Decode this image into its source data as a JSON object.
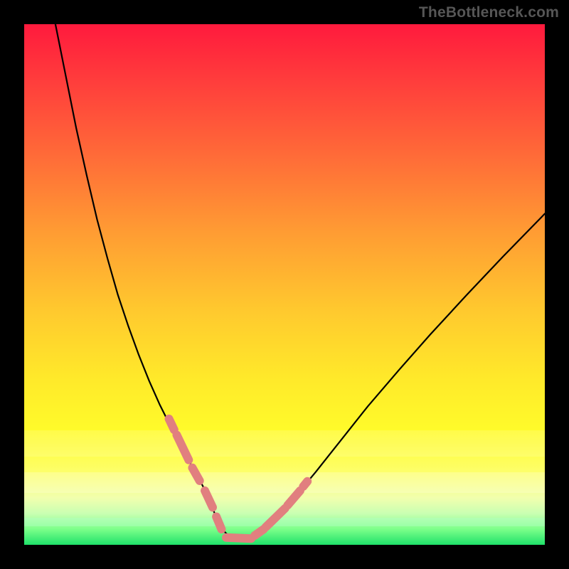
{
  "attribution": "TheBottleneck.com",
  "chart_data": {
    "type": "line",
    "title": "",
    "xlabel": "",
    "ylabel": "",
    "xlim": [
      0,
      100
    ],
    "ylim": [
      0,
      100
    ],
    "grid": false,
    "legend": false,
    "series": [
      {
        "name": "curve",
        "stroke": "#000000",
        "stroke_width": 2.2,
        "x": [
          6,
          8,
          10,
          12,
          14,
          16,
          18,
          20,
          22,
          24,
          26,
          28,
          30,
          32,
          33.5,
          35,
          36,
          37,
          38,
          39.5,
          41,
          42.5,
          44,
          47,
          51,
          56,
          61,
          66,
          72,
          78,
          85,
          92,
          100
        ],
        "y": [
          100,
          90,
          80,
          71,
          62.5,
          55,
          48,
          42,
          36.5,
          31.5,
          27,
          23,
          19,
          15.5,
          12.8,
          10,
          7.5,
          5,
          3,
          1.5,
          0.7,
          0.7,
          1.4,
          3.8,
          8,
          14,
          20.3,
          26.6,
          33.6,
          40.4,
          48,
          55.4,
          63.6
        ]
      },
      {
        "name": "bold-segments",
        "stroke": "#e17f7f",
        "stroke_width": 12,
        "pieces": [
          {
            "x": [
              27.8,
              28.8
            ],
            "y": [
              24.2,
              22.1
            ]
          },
          {
            "x": [
              29.3,
              31.6
            ],
            "y": [
              21.1,
              16.3
            ]
          },
          {
            "x": [
              32.3,
              33.7
            ],
            "y": [
              14.8,
              12.3
            ]
          },
          {
            "x": [
              34.7,
              36.2
            ],
            "y": [
              10.4,
              7.2
            ]
          },
          {
            "x": [
              36.9,
              37.9
            ],
            "y": [
              5.4,
              3.0
            ]
          },
          {
            "x": [
              38.8,
              43.6
            ],
            "y": [
              1.4,
              1.2
            ]
          },
          {
            "x": [
              44.3,
              46.0
            ],
            "y": [
              1.8,
              3.0
            ]
          },
          {
            "x": [
              46.4,
              50.1
            ],
            "y": [
              3.4,
              7.0
            ]
          },
          {
            "x": [
              50.6,
              53.0
            ],
            "y": [
              7.6,
              10.4
            ]
          },
          {
            "x": [
              53.6,
              54.4
            ],
            "y": [
              11.2,
              12.2
            ]
          }
        ]
      }
    ],
    "background": {
      "type": "vertical-gradient",
      "stops": [
        {
          "pos": 0,
          "color": "#ff1a3d"
        },
        {
          "pos": 55,
          "color": "#ffc92e"
        },
        {
          "pos": 78,
          "color": "#fffb2a"
        },
        {
          "pos": 100,
          "color": "#1fe26a"
        }
      ]
    }
  }
}
